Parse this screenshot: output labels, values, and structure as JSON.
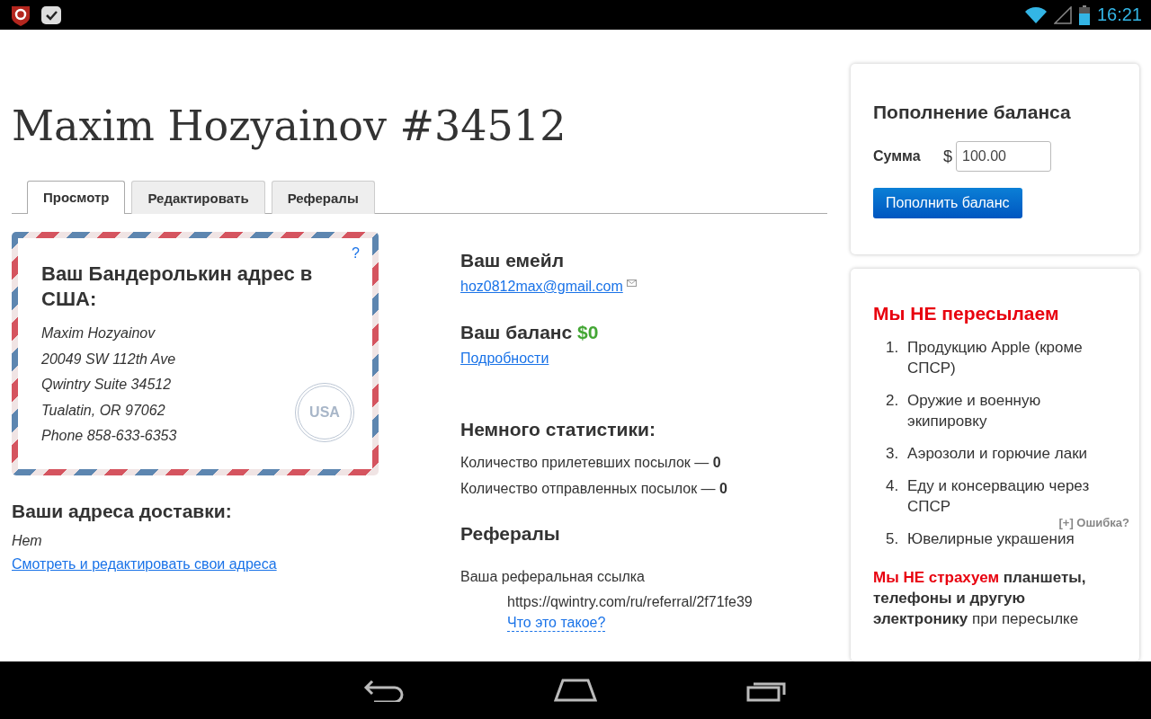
{
  "status_bar": {
    "time": "16:21"
  },
  "page_title": "Maxim Hozyainov #34512",
  "tabs": [
    {
      "label": "Просмотр",
      "selected": true
    },
    {
      "label": "Редактировать",
      "selected": false
    },
    {
      "label": "Рефералы",
      "selected": false
    }
  ],
  "address_card": {
    "help": "?",
    "heading": "Ваш Бандеролькин адрес в США:",
    "lines": [
      "Maxim Hozyainov",
      "20049 SW 112th Ave",
      "Qwintry Suite 34512",
      "Tualatin, OR 97062",
      "Phone 858-633-6353"
    ],
    "stamp": "USA"
  },
  "delivery": {
    "heading": "Ваши адреса доставки:",
    "value": "Нет",
    "link": "Смотреть и редактировать свои адреса"
  },
  "email": {
    "heading": "Ваш емейл",
    "value": "hoz0812max@gmail.com"
  },
  "balance": {
    "heading": "Ваш баланс",
    "amount": "$0",
    "link": "Подробности"
  },
  "stats": {
    "heading": "Немного статистики:",
    "lines": [
      "Количество прилетевших посылок — **0**",
      "Количество отправленных посылок — **0**"
    ]
  },
  "referrals": {
    "heading": "Рефералы",
    "label": "Ваша реферальная ссылка",
    "url": "https://qwintry.com/ru/referral/2f71fe39",
    "help_link": "Что это такое?"
  },
  "topup": {
    "heading": "Пополнение баланса",
    "amount_label": "Сумма",
    "currency": "$",
    "amount": "100.00",
    "button": "Пополнить баланс"
  },
  "restrictions": {
    "heading": "Мы НЕ пересылаем",
    "items": [
      {
        "number": "1.",
        "text": "Продукцию Apple (кроме СПСР)"
      },
      {
        "number": "2.",
        "text": "Оружие и военную экипировку"
      },
      {
        "number": "3.",
        "text": "Аэрозоли и горючие лаки"
      },
      {
        "number": "4.",
        "text": "Еду и консервацию через СПСР"
      },
      {
        "number": "5.",
        "text": "Ювелирные украшения"
      }
    ],
    "notice": [
      {
        "kind": "alert",
        "text": "Мы НЕ страхуем"
      },
      {
        "kind": "bold",
        "text": " планшеты, телефоны и другую электронику"
      },
      {
        "kind": "plain",
        "text": " при пересылке"
      }
    ]
  },
  "error_report": "[+] Ошибка?"
}
